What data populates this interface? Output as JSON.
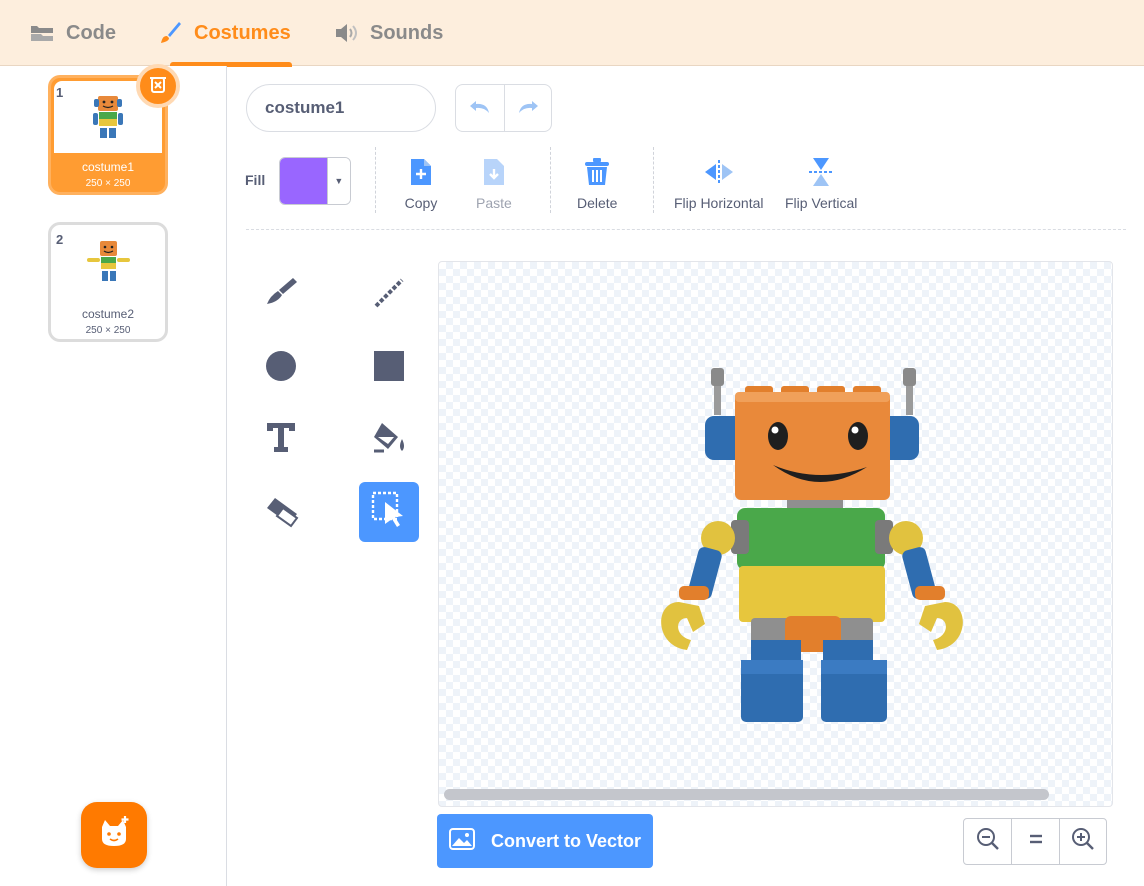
{
  "tabs": [
    {
      "label": "Code",
      "icon": "code-blocks-icon",
      "active": false
    },
    {
      "label": "Costumes",
      "icon": "paintbrush-icon",
      "active": true
    },
    {
      "label": "Sounds",
      "icon": "speaker-icon",
      "active": false
    }
  ],
  "costumes": [
    {
      "number": "1",
      "name": "costume1",
      "size": "250 × 250",
      "selected": true
    },
    {
      "number": "2",
      "name": "costume2",
      "size": "250 × 250",
      "selected": false
    }
  ],
  "editor": {
    "costume_name": "costume1",
    "fill_label": "Fill",
    "fill_color": "#9966ff",
    "toolbar": {
      "copy": "Copy",
      "paste": "Paste",
      "delete": "Delete",
      "flip_horizontal": "Flip Horizontal",
      "flip_vertical": "Flip Vertical"
    },
    "tools": [
      "brush-icon",
      "line-icon",
      "circle-icon",
      "rectangle-icon",
      "text-icon",
      "fill-bucket-icon",
      "eraser-icon",
      "select-icon"
    ],
    "active_tool": "select-icon",
    "convert_button": "Convert to Vector"
  },
  "colors": {
    "accent": "#ff8c1a",
    "primary_blue": "#4c97ff",
    "text": "#575e75"
  }
}
